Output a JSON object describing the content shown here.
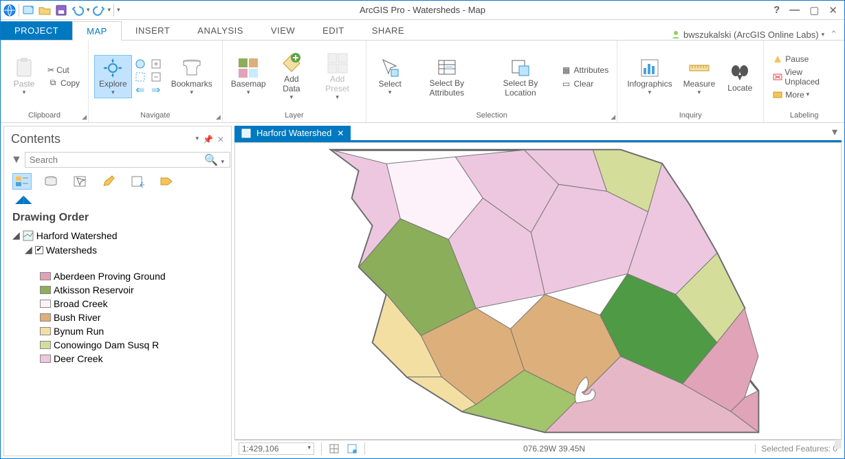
{
  "window": {
    "title": "ArcGIS Pro - Watersheds - Map"
  },
  "qat_tooltip": "",
  "tabs": {
    "project": "PROJECT",
    "list": [
      "MAP",
      "INSERT",
      "ANALYSIS",
      "VIEW",
      "EDIT",
      "SHARE"
    ],
    "active": "MAP"
  },
  "user": {
    "display": "bwszukalski (ArcGIS Online Labs)"
  },
  "ribbon": {
    "clipboard": {
      "paste": "Paste",
      "cut": "Cut",
      "copy": "Copy",
      "label": "Clipboard"
    },
    "navigate": {
      "explore": "Explore",
      "bookmarks": "Bookmarks",
      "label": "Navigate"
    },
    "layer": {
      "basemap": "Basemap",
      "add_data": "Add Data",
      "add_preset": "Add Preset",
      "add_preset_sub": " ",
      "label": "Layer"
    },
    "selection": {
      "select": "Select",
      "by_attr": "Select By Attributes",
      "by_loc": "Select By Location",
      "attributes": "Attributes",
      "clear": "Clear",
      "label": "Selection"
    },
    "inquiry": {
      "infographics": "Infographics",
      "measure": "Measure",
      "locate": "Locate",
      "label": "Inquiry"
    },
    "labeling": {
      "pause": "Pause",
      "unplaced": "View Unplaced",
      "more": "More",
      "label": "Labeling"
    }
  },
  "contents": {
    "title": "Contents",
    "search_placeholder": "Search",
    "heading": "Drawing Order",
    "map_name": "Harford Watershed",
    "layer_name": "Watersheds",
    "legend": [
      {
        "label": "Aberdeen Proving Ground",
        "color": "#e0a3b7"
      },
      {
        "label": "Atkisson Reservoir",
        "color": "#8bae5a"
      },
      {
        "label": "Broad Creek",
        "color": "#fdf1fa"
      },
      {
        "label": "Bush River",
        "color": "#ddaf7a"
      },
      {
        "label": "Bynum Run",
        "color": "#f4dfa3"
      },
      {
        "label": "Conowingo Dam Susq R",
        "color": "#d4dd9a"
      },
      {
        "label": "Deer Creek",
        "color": "#edc7df"
      }
    ]
  },
  "view": {
    "tab": "Harford Watershed"
  },
  "status": {
    "scale": "1:429,106",
    "coords": "076.29W 39.45N",
    "selected": "Selected Features: 0"
  }
}
